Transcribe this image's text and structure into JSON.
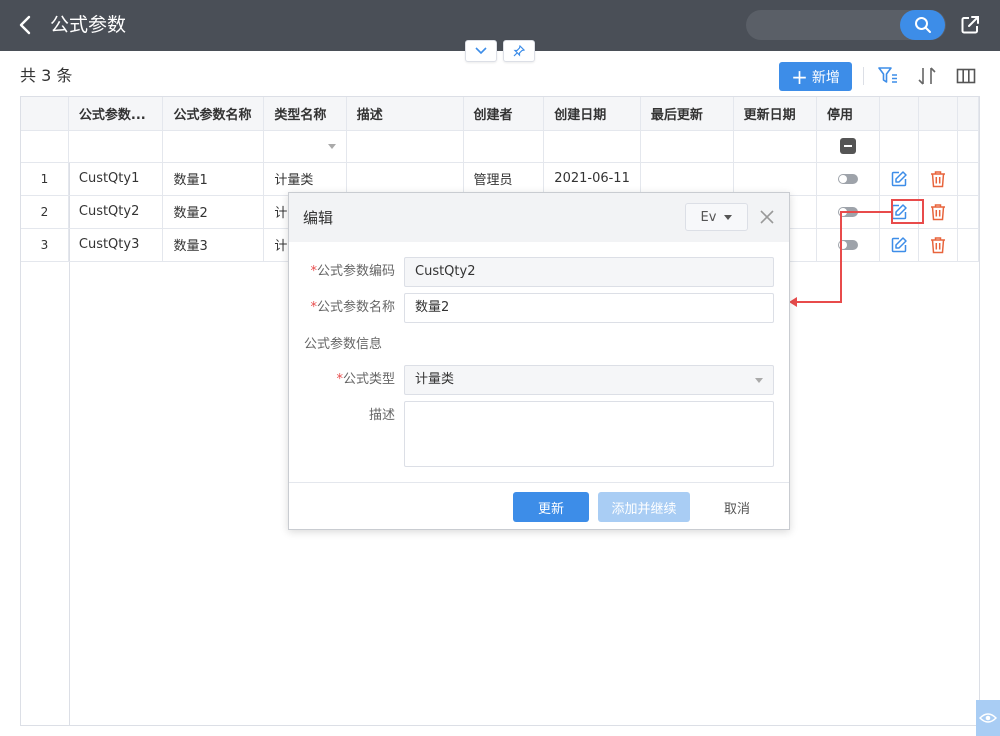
{
  "header": {
    "title": "公式参数",
    "search_placeholder": ""
  },
  "toolbar": {
    "count_label": "共 3 条",
    "add_label": "新增"
  },
  "table": {
    "columns": [
      "公式参数...",
      "公式参数名称",
      "类型名称",
      "描述",
      "创建者",
      "创建日期",
      "最后更新",
      "更新日期",
      "停用"
    ],
    "rows": [
      {
        "index": "1",
        "code": "CustQty1",
        "name": "数量1",
        "type": "计量类",
        "desc": "",
        "creator": "管理员",
        "created": "2021-06-11",
        "last_update": "",
        "updated": ""
      },
      {
        "index": "2",
        "code": "CustQty2",
        "name": "数量2",
        "type": "计",
        "desc": "",
        "creator": "",
        "created": "",
        "last_update": "",
        "updated": ""
      },
      {
        "index": "3",
        "code": "CustQty3",
        "name": "数量3",
        "type": "计",
        "desc": "",
        "creator": "",
        "created": "",
        "last_update": "",
        "updated": ""
      }
    ]
  },
  "dialog": {
    "title": "编辑",
    "lang": "Ev",
    "fields": {
      "code_label": "公式参数编码",
      "code_value": "CustQty2",
      "name_label": "公式参数名称",
      "name_value": "数量2",
      "section_label": "公式参数信息",
      "type_label": "公式类型",
      "type_value": "计量类",
      "desc_label": "描述",
      "desc_value": ""
    },
    "buttons": {
      "update": "更新",
      "add_continue": "添加并继续",
      "cancel": "取消"
    }
  },
  "colors": {
    "header_bg": "#4a4f57",
    "primary": "#3d8de8",
    "danger": "#e84b4b"
  }
}
